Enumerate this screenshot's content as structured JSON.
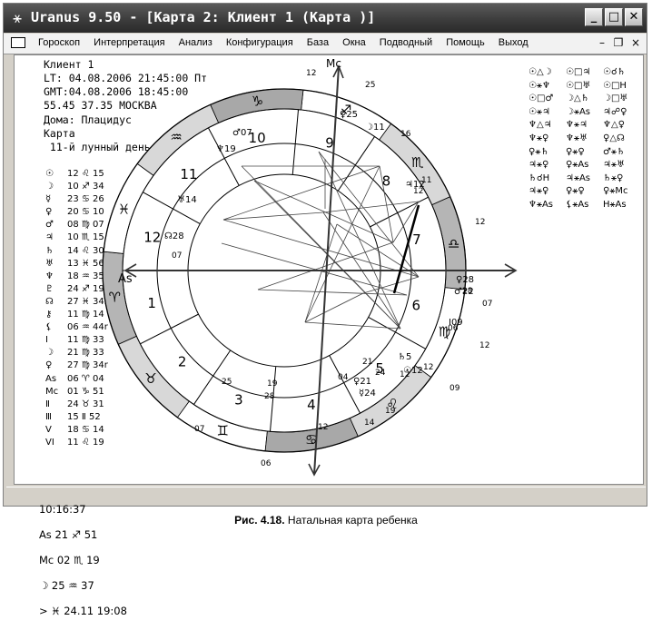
{
  "window": {
    "title": "Uranus 9.50 - [Карта 2: Клиент 1   (Карта )]",
    "app_icon": "uranus-glyph",
    "controls": [
      "minimize",
      "maximize",
      "close"
    ]
  },
  "menu": {
    "items": [
      "Гороскоп",
      "Интерпретация",
      "Анализ",
      "Конфигурация",
      "База",
      "Окна",
      "Подводный",
      "Помощь",
      "Выход"
    ]
  },
  "chart_info": {
    "client": "Клиент 1",
    "lt": "LT: 04.08.2006 21:45:00 Пт",
    "gmt": "GMT:04.08.2006 18:45:00",
    "coords": "55.45 37.35 МОСКВА",
    "houses": "Дома: Плацидус",
    "type": "Карта",
    "lunar_day": " 11-й лунный день"
  },
  "planets": [
    {
      "glyph": "☉",
      "value": "12 ♌ 15"
    },
    {
      "glyph": "☽",
      "value": "10 ♐ 34"
    },
    {
      "glyph": "☿",
      "value": "23 ♋ 26"
    },
    {
      "glyph": "♀",
      "value": "20 ♋ 10"
    },
    {
      "glyph": "♂",
      "value": "08 ♍ 07"
    },
    {
      "glyph": "♃",
      "value": "10 ♏ 15"
    },
    {
      "glyph": "♄",
      "value": "14 ♌ 30"
    },
    {
      "glyph": "♅",
      "value": "13 ♓ 56r"
    },
    {
      "glyph": "♆",
      "value": "18 ♒ 35r"
    },
    {
      "glyph": "♇",
      "value": "24 ♐ 19r"
    },
    {
      "glyph": "☊",
      "value": "27 ♓ 34r"
    },
    {
      "glyph": "⚷",
      "value": "11 ♍ 14"
    },
    {
      "glyph": "⚸",
      "value": "06 ♒ 44r"
    },
    {
      "glyph": "Ⅰ",
      "value": "11 ♍ 33"
    },
    {
      "glyph": "☽",
      "value": "21 ♍ 33"
    },
    {
      "glyph": "♀",
      "value": "27 ♍ 34r"
    },
    {
      "glyph": "As",
      "value": "06 ♈ 04"
    },
    {
      "glyph": "Mc",
      "value": "01 ♑ 51"
    },
    {
      "glyph": "Ⅱ",
      "value": "24 ♉ 31"
    },
    {
      "glyph": "Ⅲ",
      "value": "15 Ⅱ 52"
    },
    {
      "glyph": "V",
      "value": "18 ♋ 14"
    },
    {
      "glyph": "VI",
      "value": "11 ♌ 19"
    }
  ],
  "aspects": [
    [
      "☉△☽",
      "☉□♃",
      "☉☌♄"
    ],
    [
      "☉⚹♆",
      "☉□♅",
      "☉□H"
    ],
    [
      "☉□♂",
      "☽△♄",
      "☽□♅"
    ],
    [
      "☉⚹♃",
      "☽⚹As",
      "♃☍♀"
    ],
    [
      "♆△♃",
      "♆⚹♃",
      "♆△♀"
    ],
    [
      "♆⚹♀",
      "♆⚹♅",
      "♀△☊"
    ],
    [
      "♀⚹♄",
      "♀⚹♀",
      "♂⚹♄"
    ],
    [
      "♃⚹♀",
      "♀⚹As",
      "♃⚹♅"
    ],
    [
      "♄☌H",
      "♃⚹As",
      "♄⚹♀"
    ],
    [
      "♃⚹♀",
      "♀⚹♀",
      "♀⚹Mc"
    ],
    [
      "♆⚹As",
      "⚸⚹As",
      "H⚹As"
    ]
  ],
  "wheel": {
    "mc_label": "Mc",
    "as_label": "As",
    "house_numbers": [
      "1",
      "2",
      "3",
      "4",
      "5",
      "6",
      "7",
      "8",
      "9",
      "10",
      "11",
      "12"
    ],
    "signs": [
      "♈",
      "♉",
      "♊",
      "♋",
      "♌",
      "♍",
      "♎",
      "♏",
      "♐",
      "♑",
      "♒",
      "♓"
    ],
    "degree_labels": [
      "12",
      "25",
      "16",
      "12",
      "11",
      "12",
      "28",
      "07",
      "06",
      "12",
      "04",
      "14",
      "19",
      "28",
      "07",
      "25",
      "06",
      "12",
      "19",
      "21",
      "24",
      "12",
      "09",
      "12",
      "07"
    ],
    "planet_marks": [
      "♀25",
      "☽11",
      "♃12",
      "♂07",
      "♆19",
      "♅14",
      "☊28",
      "♄5",
      "☉12",
      "♀21",
      "☿24",
      "♀28",
      "♂22",
      "Ⅰ09"
    ]
  },
  "status": {
    "time": "10:16:37",
    "as": "As 21 ♐ 51",
    "mc": "Mc 02 ♏ 19",
    "moon": "☽ 25 ♒ 37",
    "next": "> ♓ 24.11 19:08"
  },
  "caption": {
    "label": "Рис. 4.18.",
    "text": "Натальная карта ребенка"
  }
}
